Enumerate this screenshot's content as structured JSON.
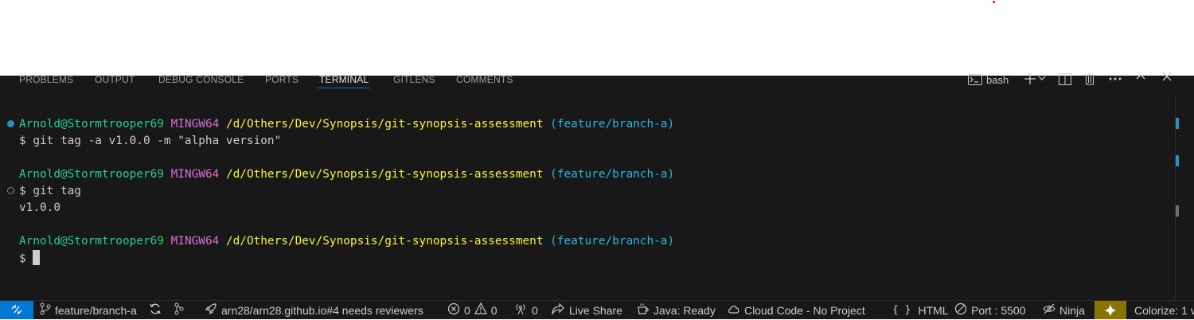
{
  "panel": {
    "tabs": [
      {
        "label": "PROBLEMS"
      },
      {
        "label": "OUTPUT"
      },
      {
        "label": "DEBUG CONSOLE"
      },
      {
        "label": "PORTS"
      },
      {
        "label": "TERMINAL",
        "active": true
      },
      {
        "label": "GITLENS"
      },
      {
        "label": "COMMENTS"
      }
    ],
    "terminal_name": "bash"
  },
  "terminal": {
    "prompts": [
      {
        "user": "Arnold@Stormtrooper69",
        "system": "MINGW64",
        "path": "/d/Others/Dev/Synopsis/git-synopsis-assessment",
        "branch": "(feature/branch-a)",
        "command": "$ git tag -a v1.0.0 -m \"alpha version\"",
        "output": ""
      },
      {
        "user": "Arnold@Stormtrooper69",
        "system": "MINGW64",
        "path": "/d/Others/Dev/Synopsis/git-synopsis-assessment",
        "branch": "(feature/branch-a)",
        "command": "$ git tag",
        "output": "v1.0.0"
      },
      {
        "user": "Arnold@Stormtrooper69",
        "system": "MINGW64",
        "path": "/d/Others/Dev/Synopsis/git-synopsis-assessment",
        "branch": "(feature/branch-a)",
        "command": "$ ",
        "output": ""
      }
    ]
  },
  "statusbar": {
    "branch": "feature/branch-a",
    "pr": "arn28/arn28.github.io#4 needs reviewers",
    "errors": "0",
    "warnings": "0",
    "ports": "0",
    "live_share": "Live Share",
    "java": "Java: Ready",
    "cloud_code": "Cloud Code - No Project",
    "language": "HTML",
    "port": "Port : 5500",
    "ninja": "Ninja",
    "colorize": "Colorize: 1 v"
  },
  "colors": {
    "panel_bg": "#181818",
    "accent": "#0078d4",
    "user": "#23d18b",
    "system": "#d670d6",
    "path": "#f5f543",
    "branch": "#29b8db"
  }
}
